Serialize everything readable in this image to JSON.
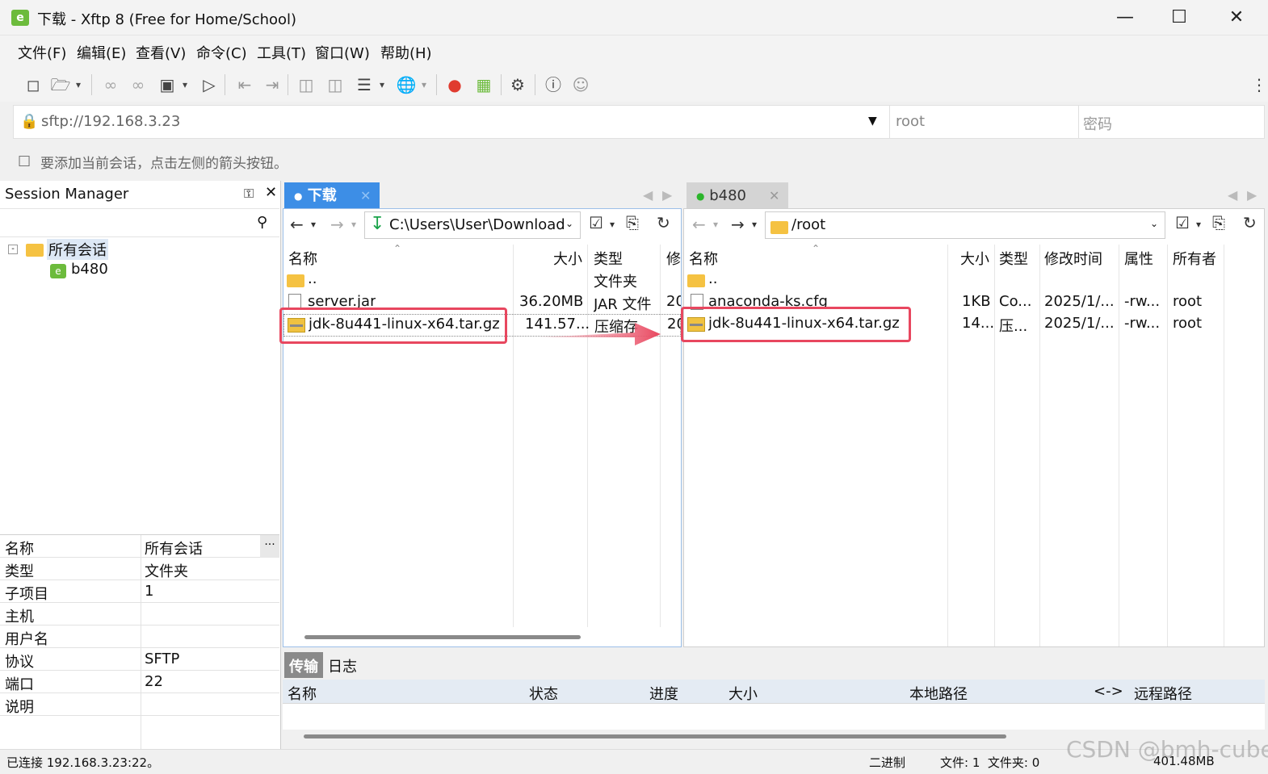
{
  "window": {
    "title": "下载 - Xftp 8 (Free for Home/School)",
    "app_icon": "xftp-app-icon"
  },
  "menu": [
    "文件(F)",
    "编辑(E)",
    "查看(V)",
    "命令(C)",
    "工具(T)",
    "窗口(W)",
    "帮助(H)"
  ],
  "address": {
    "url": "sftp://192.168.3.23",
    "user": "root",
    "password_placeholder": "密码"
  },
  "hint": "要添加当前会话，点击左侧的箭头按钮。",
  "session_manager": {
    "title": "Session Manager",
    "tree": {
      "root": "所有会话",
      "child": "b480"
    },
    "properties": [
      {
        "k": "名称",
        "v": "所有会话"
      },
      {
        "k": "类型",
        "v": "文件夹"
      },
      {
        "k": "子项目",
        "v": "1"
      },
      {
        "k": "主机",
        "v": ""
      },
      {
        "k": "用户名",
        "v": ""
      },
      {
        "k": "协议",
        "v": "SFTP"
      },
      {
        "k": "端口",
        "v": "22"
      },
      {
        "k": "说明",
        "v": ""
      }
    ],
    "more": "..."
  },
  "local": {
    "tab": "下载",
    "path": "C:\\Users\\User\\Download",
    "columns": {
      "name": "名称",
      "size": "大小",
      "type": "类型",
      "modified": "修"
    },
    "rows": [
      {
        "name": "..",
        "size": "",
        "type": "文件夹",
        "mod": ""
      },
      {
        "name": "server.jar",
        "size": "36.20MB",
        "type": "JAR 文件",
        "mod": "20"
      },
      {
        "name": "jdk-8u441-linux-x64.tar.gz",
        "size": "141.57...",
        "type": "压缩存",
        "mod": "20"
      }
    ]
  },
  "remote": {
    "tab": "b480",
    "path": "/root",
    "columns": {
      "name": "名称",
      "size": "大小",
      "type": "类型",
      "modified": "修改时间",
      "attr": "属性",
      "owner": "所有者"
    },
    "rows": [
      {
        "name": "..",
        "size": "",
        "type": "",
        "mod": "",
        "attr": "",
        "owner": ""
      },
      {
        "name": "anaconda-ks.cfg",
        "size": "1KB",
        "type": "Co...",
        "mod": "2025/1/...",
        "attr": "-rw...",
        "owner": "root"
      },
      {
        "name": "jdk-8u441-linux-x64.tar.gz",
        "size": "14...",
        "type": "压...",
        "mod": "2025/1/...",
        "attr": "-rw...",
        "owner": "root"
      }
    ]
  },
  "transfer": {
    "tabs": [
      "传输",
      "日志"
    ],
    "columns": [
      "名称",
      "状态",
      "进度",
      "大小",
      "本地路径",
      "<->",
      "远程路径"
    ]
  },
  "status": {
    "connected": "已连接 192.168.3.23:22。",
    "mode": "二进制",
    "files": "文件: 1  文件夹: 0",
    "size": "401.48MB"
  },
  "watermark": "CSDN @bmh-cube",
  "colors": {
    "accent": "#4a90e2",
    "highlight": "#e8475f",
    "tab_active": "#3d8ee6"
  }
}
